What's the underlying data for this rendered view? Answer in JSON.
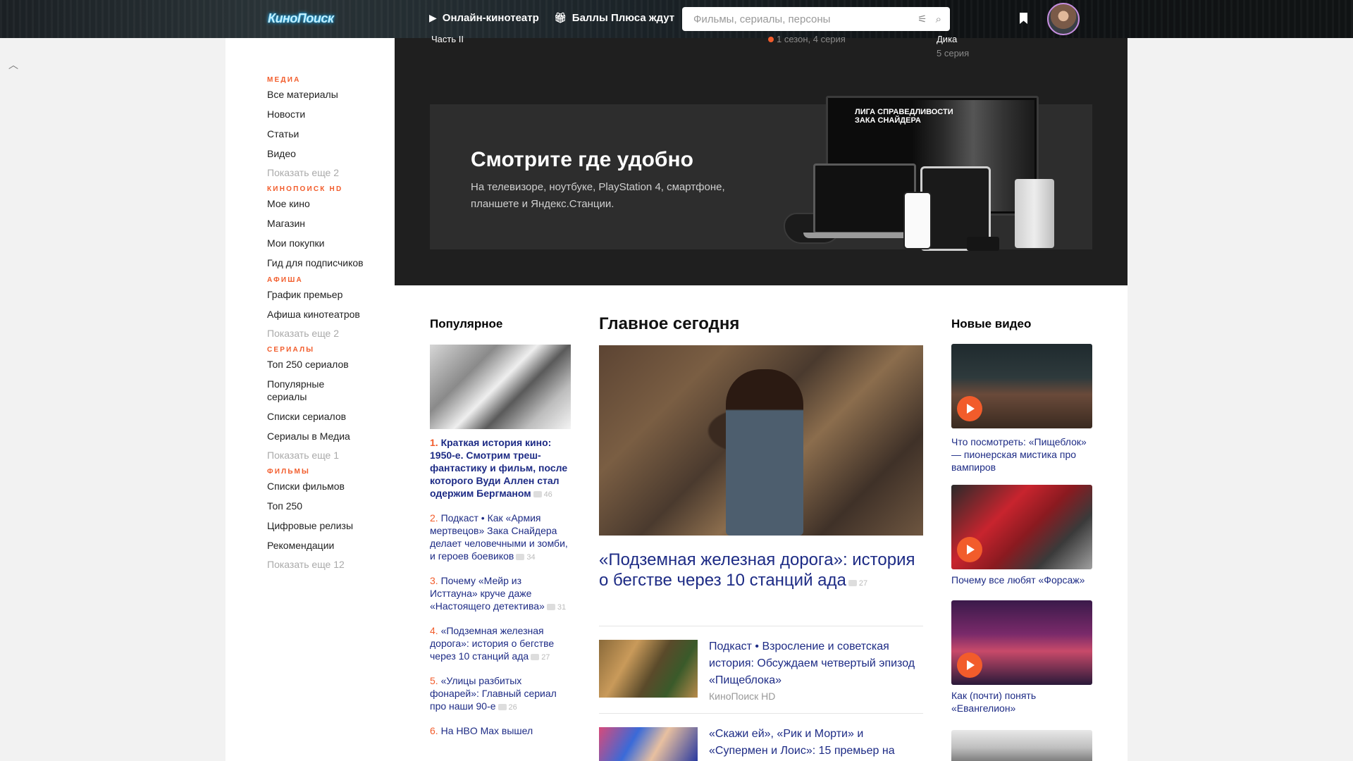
{
  "header": {
    "logo": "КиноПоиск",
    "online_cinema": "Онлайн-кинотеатр",
    "plus_points": "Баллы Плюса ждут",
    "search_placeholder": "Фильмы, сериалы, персоны"
  },
  "sidebar": {
    "media": {
      "heading": "Медиа",
      "items": [
        "Все материалы",
        "Новости",
        "Статьи",
        "Видео"
      ],
      "more": "Показать еще 2"
    },
    "hd": {
      "heading": "КиноПоиск HD",
      "items": [
        "Мое кино",
        "Магазин",
        "Мои покупки",
        "Гид для подписчиков"
      ]
    },
    "afisha": {
      "heading": "Афиша",
      "items": [
        "График премьер",
        "Афиша кинотеатров"
      ],
      "more": "Показать еще 2"
    },
    "series": {
      "heading": "Сериалы",
      "items": [
        "Топ 250 сериалов",
        "Популярные сериалы",
        "Списки сериалов",
        "Сериалы в Медиа"
      ],
      "more": "Показать еще 1"
    },
    "films": {
      "heading": "Фильмы",
      "items": [
        "Списки фильмов",
        "Топ 250",
        "Цифровые релизы",
        "Рекомендации"
      ],
      "more": "Показать еще 12"
    }
  },
  "band": {
    "item1_title": "Часть II",
    "item2_sub": "1 сезон, 4 серия",
    "item3_title": "Дика",
    "item3_sub": "5 серия"
  },
  "promo": {
    "title": "Смотрите где удобно",
    "text": "На телевизоре, ноутбуке, PlayStation 4, смартфоне, планшете и Яндекс.Станции.",
    "tv_title": "ЛИГА СПРАВЕДЛИВОСТИ\nЗАКА СНАЙДЕРА"
  },
  "popular": {
    "title": "Популярное",
    "items": [
      {
        "num": "1.",
        "text": "Краткая история кино: 1950-е. Смотрим треш-фантастику и фильм, после которого Вуди Аллен стал одержим Бергманом",
        "count": "46"
      },
      {
        "num": "2.",
        "text": "Подкаст • Как «Армия мертвецов» Зака Снайдера делает человечными и зомби, и героев боевиков",
        "count": "34"
      },
      {
        "num": "3.",
        "text": "Почему «Мейр из Исттауна» круче даже «Настоящего детектива»",
        "count": "31"
      },
      {
        "num": "4.",
        "text": "«Подземная железная дорога»: история о бегстве через 10 станций ада",
        "count": "27"
      },
      {
        "num": "5.",
        "text": "«Улицы разбитых фонарей»: Главный сериал про наши 90-е",
        "count": "26"
      },
      {
        "num": "6.",
        "text": "На HBO Max вышел",
        "count": ""
      }
    ]
  },
  "main": {
    "title": "Главное сегодня",
    "headline": "«Подземная железная дорога»: история о бегстве через 10 станций ада",
    "headline_count": "27",
    "news": [
      {
        "text": "Подкаст • Взросление и советская история: Обсуждаем четвертый эпизод «Пищеблока»",
        "source": "КиноПоиск HD"
      },
      {
        "text": "«Скажи ей», «Рик и Морти» и «Супермен и Лоис»: 15 премьер на",
        "source": ""
      }
    ]
  },
  "videos": {
    "title": "Новые видео",
    "items": [
      {
        "caption": "Что посмотреть: «Пищеблок» — пионерская мистика про вампиров"
      },
      {
        "caption": "Почему все любят «Форсаж»"
      },
      {
        "caption": "Как (почти) понять «Евангелион»"
      }
    ]
  },
  "colors": {
    "accent": "#f25c2b",
    "link": "#1d2b85",
    "dark_band": "#1f1f1f"
  }
}
